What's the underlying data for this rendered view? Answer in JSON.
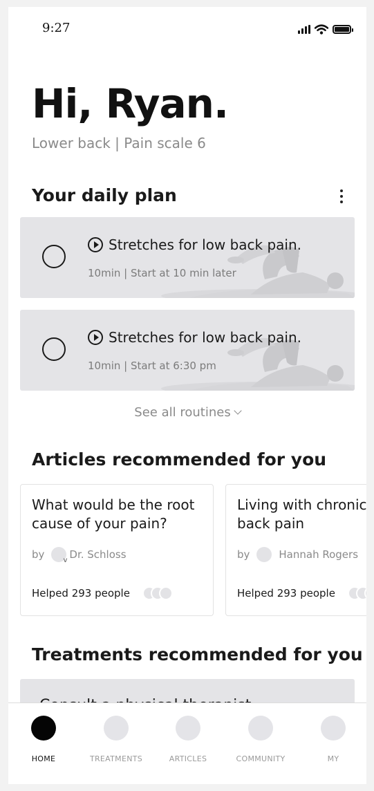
{
  "status_bar": {
    "time": "9:27"
  },
  "header": {
    "greeting": "Hi, Ryan.",
    "subtitle": "Lower back | Pain scale 6"
  },
  "daily_plan": {
    "title": "Your daily plan",
    "items": [
      {
        "title": "Stretches for low back pain.",
        "meta": "10min  |  Start at 10 min later"
      },
      {
        "title": "Stretches for low back pain.",
        "meta": "10min  |  Start at 6:30 pm"
      }
    ],
    "see_all": "See all routines"
  },
  "articles": {
    "title": "Articles recommended for you",
    "items": [
      {
        "title": "What would be the root\ncause of your pain?",
        "by": "by",
        "author": "Dr. Schloss",
        "author_badge": "v",
        "helped": "Helped 293 people"
      },
      {
        "title": "Living with chronic\nback pain",
        "by": "by",
        "author": "Hannah Rogers",
        "helped": "Helped 293 people"
      }
    ]
  },
  "treatments": {
    "title": "Treatments recommended for you",
    "items": [
      {
        "title": "Consult a physical therapist"
      }
    ]
  },
  "nav": {
    "items": [
      {
        "label": "HOME",
        "active": true
      },
      {
        "label": "TREATMENTS"
      },
      {
        "label": "ARTICLES"
      },
      {
        "label": "COMMUNITY"
      },
      {
        "label": "MY"
      }
    ]
  },
  "colors": {
    "card_bg": "#e4e4e7",
    "nav_active": "#050505",
    "nav_inactive": "#e4e4e8",
    "muted_text": "#8a8a8a"
  }
}
